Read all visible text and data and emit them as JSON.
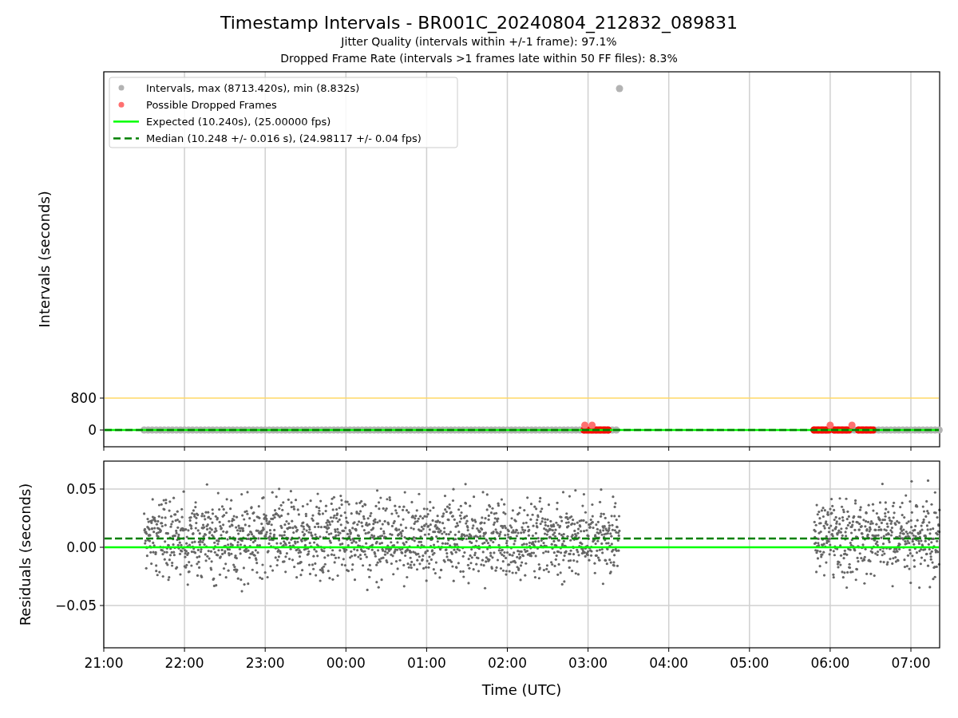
{
  "figure": {
    "title": "Timestamp Intervals - BR001C_20240804_212832_089831",
    "subtitle_lines": [
      "Jitter Quality (intervals within +/-1 frame): 97.1%",
      "Dropped Frame Rate (intervals >1 frames late within 50 FF files): 8.3%"
    ]
  },
  "intervals_panel": {
    "y_axis_label": "Intervals (seconds)",
    "y_tick_labels": [
      "800",
      "0"
    ],
    "legend": [
      {
        "label": "Intervals, max (8713.420s), min (8.832s)",
        "kind": "dot",
        "color": "#b3b3b3"
      },
      {
        "label": "Possible Dropped Frames",
        "kind": "dot",
        "color": "#ff7070"
      },
      {
        "label": "Expected (10.240s), (25.00000 fps)",
        "kind": "line",
        "color": "#00ff00"
      },
      {
        "label": "Median (10.248 +/- 0.016 s), (24.98117 +/- 0.04 fps)",
        "kind": "dashed",
        "color": "#008000"
      }
    ]
  },
  "residuals_panel": {
    "y_axis_label": "Residuals (seconds)",
    "y_tick_labels": [
      "0.05",
      "0.00",
      "−0.05"
    ],
    "x_tick_labels": [
      "21:00",
      "22:00",
      "23:00",
      "00:00",
      "01:00",
      "02:00",
      "03:00",
      "04:00",
      "05:00",
      "06:00",
      "07:00"
    ],
    "x_axis_label": "Time (UTC)"
  }
}
